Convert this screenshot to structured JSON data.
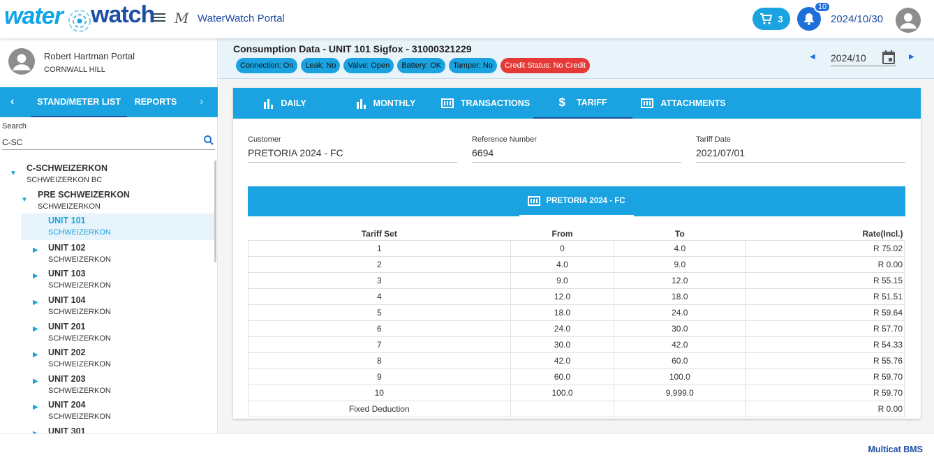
{
  "app": {
    "logo_left": "water",
    "logo_right": "watch",
    "title": "WaterWatch Portal",
    "cart_count": "3",
    "notification_count": "10",
    "date": "2024/10/30"
  },
  "user": {
    "name": "Robert Hartman Portal",
    "location": "CORNWALL HILL"
  },
  "sidebar": {
    "tabs": [
      "STAND/METER LIST",
      "REPORTS"
    ],
    "search_label": "Search",
    "search_value": "C-SC",
    "tree": [
      {
        "title": "C-SCHWEIZERKON",
        "subtitle": "SCHWEIZERKON BC",
        "level": 0,
        "expanded": true
      },
      {
        "title": "PRE SCHWEIZERKON",
        "subtitle": "SCHWEIZERKON",
        "level": 1,
        "expanded": true
      },
      {
        "title": "UNIT 101",
        "subtitle": "SCHWEIZERKON",
        "level": 2,
        "selected": true
      },
      {
        "title": "UNIT 102",
        "subtitle": "SCHWEIZERKON",
        "level": 2
      },
      {
        "title": "UNIT 103",
        "subtitle": "SCHWEIZERKON",
        "level": 2
      },
      {
        "title": "UNIT 104",
        "subtitle": "SCHWEIZERKON",
        "level": 2
      },
      {
        "title": "UNIT 201",
        "subtitle": "SCHWEIZERKON",
        "level": 2
      },
      {
        "title": "UNIT 202",
        "subtitle": "SCHWEIZERKON",
        "level": 2
      },
      {
        "title": "UNIT 203",
        "subtitle": "SCHWEIZERKON",
        "level": 2
      },
      {
        "title": "UNIT 204",
        "subtitle": "SCHWEIZERKON",
        "level": 2
      },
      {
        "title": "UNIT 301",
        "subtitle": "",
        "level": 2
      }
    ]
  },
  "header": {
    "title": "Consumption Data - UNIT 101 Sigfox - 31000321229",
    "badges": [
      {
        "label": "Connection: On",
        "color": "#1aa3e0"
      },
      {
        "label": "Leak: No",
        "color": "#1aa3e0"
      },
      {
        "label": "Valve: Open",
        "color": "#1aa3e0"
      },
      {
        "label": "Battery: OK",
        "color": "#1aa3e0"
      },
      {
        "label": "Tamper: No",
        "color": "#1aa3e0"
      },
      {
        "label": "Credit Status: No Credit",
        "color": "#e53935"
      }
    ],
    "month": "2024/10"
  },
  "tabs": [
    {
      "label": "DAILY",
      "icon": "bar-chart-icon"
    },
    {
      "label": "MONTHLY",
      "icon": "bar-chart-icon"
    },
    {
      "label": "TRANSACTIONS",
      "icon": "meter-icon"
    },
    {
      "label": "TARIFF",
      "icon": "dollar-icon",
      "active": true
    },
    {
      "label": "ATTACHMENTS",
      "icon": "meter-icon"
    }
  ],
  "tariff": {
    "customer_label": "Customer",
    "customer": "PRETORIA 2024 - FC",
    "reference_label": "Reference Number",
    "reference": "6694",
    "date_label": "Tariff Date",
    "date": "2021/07/01",
    "sub_tab": "PRETORIA 2024 - FC",
    "columns": [
      "Tariff Set",
      "From",
      "To",
      "Rate(Incl.)"
    ],
    "rows": [
      [
        "1",
        "0",
        "4.0",
        "R 75.02"
      ],
      [
        "2",
        "4.0",
        "9.0",
        "R 0.00"
      ],
      [
        "3",
        "9.0",
        "12.0",
        "R 55.15"
      ],
      [
        "4",
        "12.0",
        "18.0",
        "R 51.51"
      ],
      [
        "5",
        "18.0",
        "24.0",
        "R 59.64"
      ],
      [
        "6",
        "24.0",
        "30.0",
        "R 57.70"
      ],
      [
        "7",
        "30.0",
        "42.0",
        "R 54.33"
      ],
      [
        "8",
        "42.0",
        "60.0",
        "R 55.76"
      ],
      [
        "9",
        "60.0",
        "100.0",
        "R 59.70"
      ],
      [
        "10",
        "100.0",
        "9,999.0",
        "R 59.70"
      ],
      [
        "Fixed Deduction",
        "",
        "",
        "R 0.00"
      ]
    ]
  },
  "footer": {
    "text": "Multicat BMS"
  }
}
